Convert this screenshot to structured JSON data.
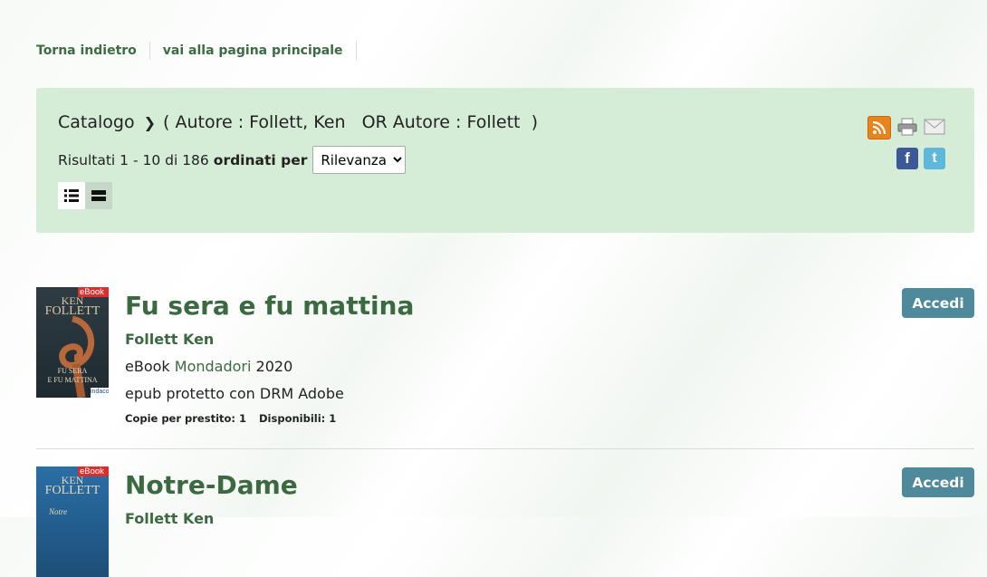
{
  "nav": {
    "back": "Torna indietro",
    "home": "vai alla pagina principale"
  },
  "search": {
    "catalog": "Catalogo",
    "query_open": "(",
    "query_text": " Autore : Follett, Ken   OR Autore : Follett  ",
    "query_close": ")",
    "results_text": "Risultati 1 - 10 di 186",
    "sort_label": "ordinati per",
    "sort_selected": "Rilevanza"
  },
  "icons": {
    "rss": "rss-icon",
    "print": "printer-icon",
    "email": "envelope-icon",
    "facebook": "facebook-icon",
    "twitter": "twitter-icon",
    "view_list": "list-view-icon",
    "view_full": "full-view-icon"
  },
  "colors": {
    "accent": "#3c6a40",
    "panel": "#d5ecd6",
    "button": "#4f8a9c"
  },
  "items": [
    {
      "title": "Fu sera e fu mattina",
      "author": "Follett Ken",
      "format": "eBook",
      "publisher": "Mondadori",
      "year": "2020",
      "drm": "epub protetto con DRM Adobe",
      "copies": "Copie per prestito: 1",
      "available": "Disponibili: 1",
      "action": "Accedi",
      "cover": {
        "badge": "eBook",
        "author_top": "KEN",
        "author_bottom": "FOLLETT",
        "cover_title_1": "FU SERA",
        "cover_title_2": "E FU MATTINA",
        "logo": "indaco"
      }
    },
    {
      "title": "Notre-Dame",
      "author": "Follett Ken",
      "action": "Accedi",
      "cover": {
        "badge": "eBook",
        "author_top": "KEN",
        "author_bottom": "FOLLETT",
        "cover_title_1": "Notre"
      }
    }
  ]
}
